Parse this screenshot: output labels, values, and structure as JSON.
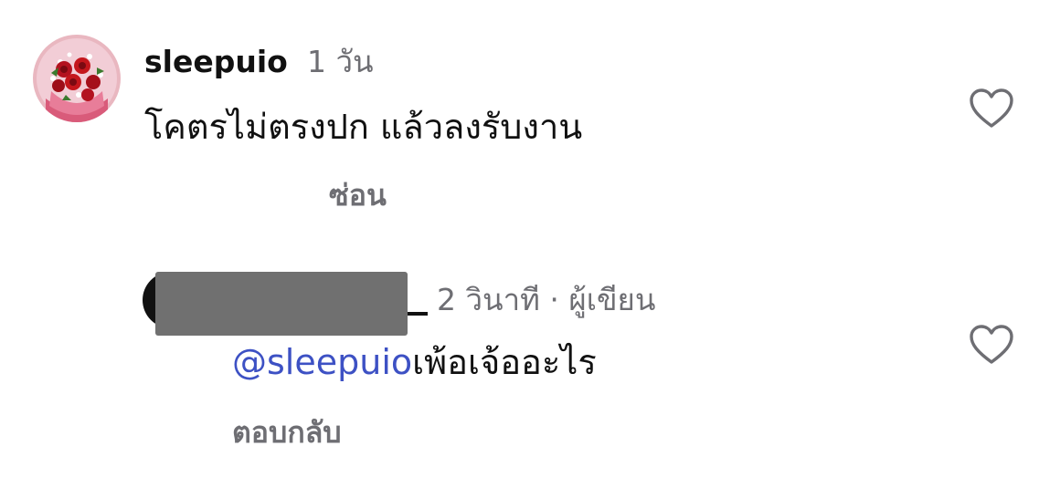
{
  "comment": {
    "username": "sleepuio",
    "time": "1 วัน",
    "text": "โคตรไม่ตรงปก แล้วลงรับงาน",
    "hide_label": "ซ่อน",
    "avatar_icon": "rose-bouquet-avatar",
    "like_icon": "heart-outline-icon"
  },
  "reply": {
    "time": "2 วินาที",
    "separator": "·",
    "author_badge": "ผู้เขียน",
    "mention": "@sleepuio",
    "text": "เพ้อเจ้ออะไร",
    "reply_label": "ตอบกลับ",
    "like_icon": "heart-outline-icon"
  },
  "colors": {
    "mention": "#3d51c4",
    "secondary_text": "#6e6e73",
    "primary_text": "#111111"
  }
}
